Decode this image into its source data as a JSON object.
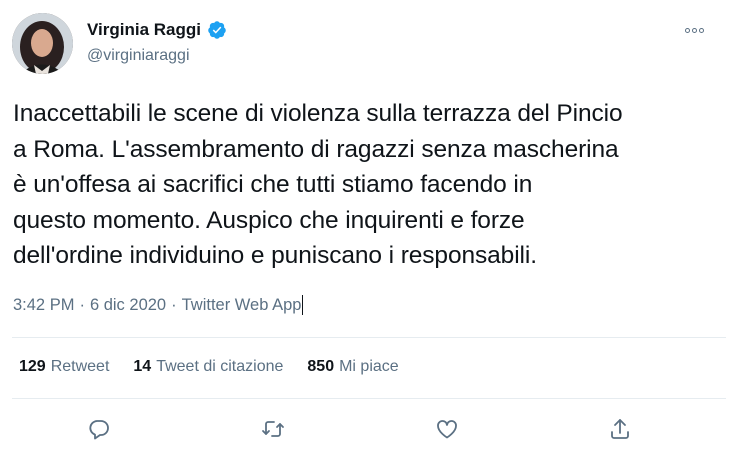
{
  "author": {
    "display_name": "Virginia Raggi",
    "handle": "@virginiaraggi",
    "verified": true
  },
  "tweet": {
    "text": "Inaccettabili le scene di violenza sulla terrazza del Pincio\na Roma. L'assembramento di ragazzi senza mascherina\nè un'offesa ai sacrifici che tutti stiamo facendo in\nquesto momento. Auspico che inquirenti e forze\ndell'ordine individuino e puniscano i responsabili.",
    "time": "3:42 PM",
    "separator": "·",
    "date": "6 dic 2020",
    "source": "Twitter Web App"
  },
  "stats": {
    "retweets_count": "129",
    "retweets_label": "Retweet",
    "quotes_count": "14",
    "quotes_label": "Tweet di citazione",
    "likes_count": "850",
    "likes_label": "Mi piace"
  },
  "colors": {
    "text": "#0f1419",
    "secondary": "#5b7083",
    "verified": "#1da1f2",
    "divider": "#e6ecf0"
  },
  "icons": {
    "reply": "reply-icon",
    "retweet": "retweet-icon",
    "like": "like-icon",
    "share": "share-icon",
    "more": "more-icon"
  }
}
